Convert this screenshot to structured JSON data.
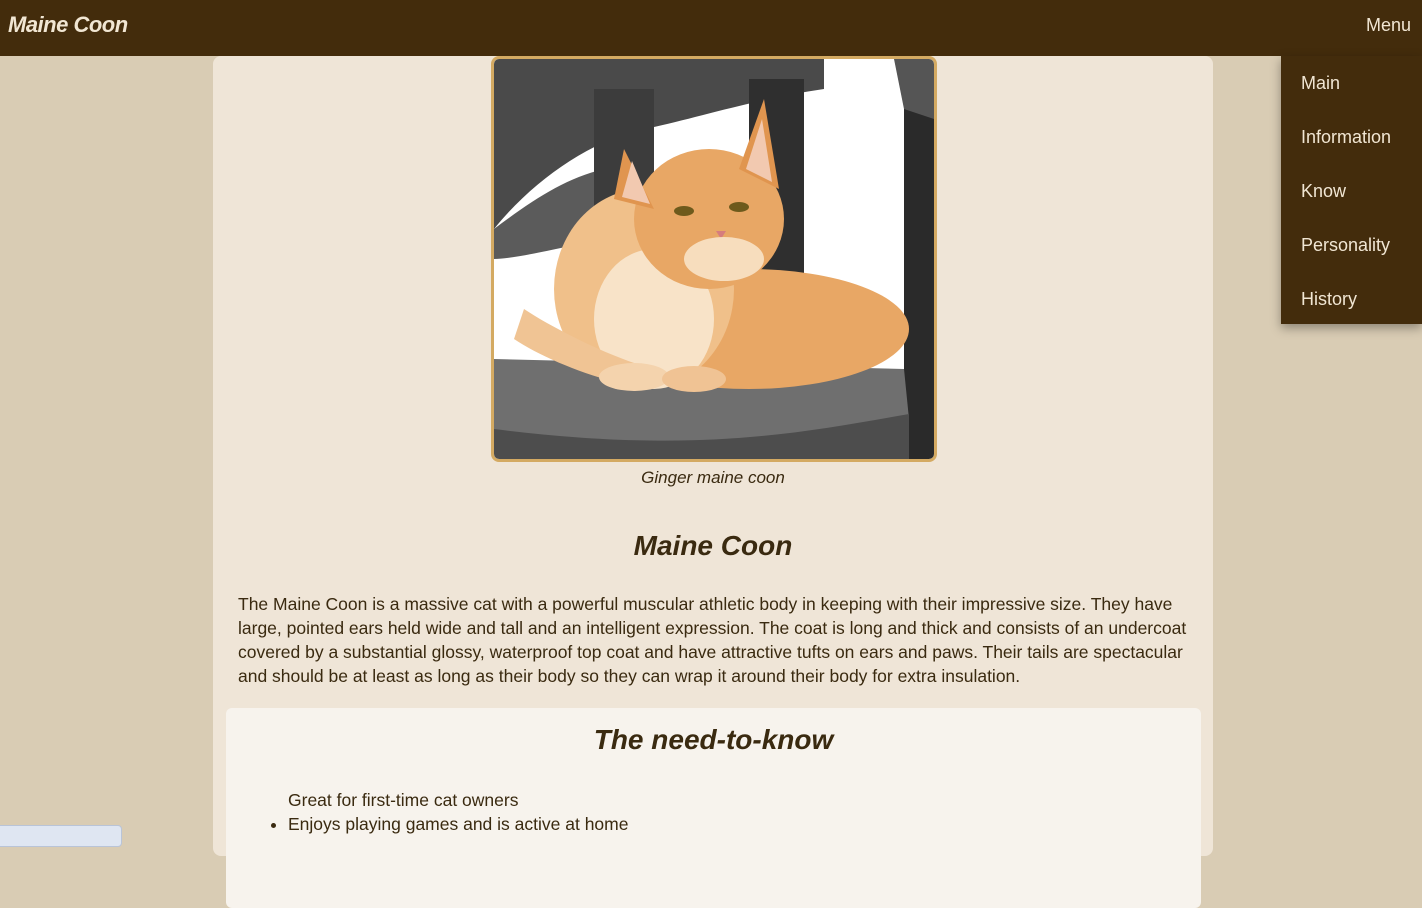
{
  "header": {
    "title": "Maine Coon",
    "menu_label": "Menu"
  },
  "menu": {
    "items": [
      "Main",
      "Information",
      "Know",
      "Personality",
      "History"
    ]
  },
  "hero": {
    "image_alt": "Ginger maine coon",
    "caption": "Ginger maine coon"
  },
  "main": {
    "title": "Maine Coon",
    "intro": "The Maine Coon is a massive cat with a powerful muscular athletic body in keeping with their impressive size. They have large, pointed ears held wide and tall and an intelligent expression. The coat is long and thick and consists of an undercoat covered by a substantial glossy, waterproof top coat and have attractive tufts on ears and paws. Their tails are spectacular and should be at least as long as their body so they can wrap it around their body for extra insulation."
  },
  "need_to_know": {
    "title": "The need-to-know",
    "items": [
      "Great for first-time cat owners",
      "Enjoys playing games and is active at home"
    ]
  },
  "colors": {
    "header_bg": "#432c0c",
    "page_bg": "#d9ccb4",
    "content_bg": "#efe5d7",
    "card_bg": "#f7f3ed",
    "frame_border": "#d4aa62",
    "text": "#3a2a10"
  }
}
